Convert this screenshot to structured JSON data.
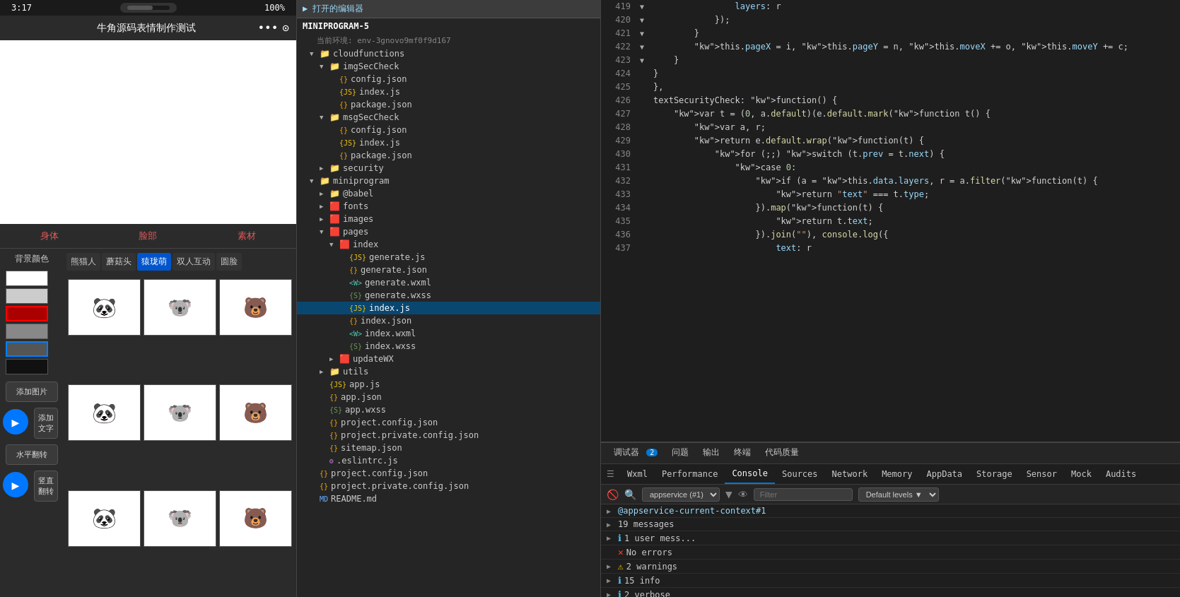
{
  "phone": {
    "status_time": "3:17",
    "status_battery": "100%",
    "title": "牛角源码表情制作测试",
    "tabs": [
      "身体",
      "脸部",
      "素材"
    ],
    "bg_label": "背景颜色",
    "categories": [
      "熊猫人",
      "蘑菇头",
      "猿珑萌",
      "双人互动",
      "圆脸"
    ],
    "btn_add_img": "添加图片",
    "btn_add_txt": "添加文字",
    "btn_hflip": "水平翻转",
    "btn_vflip": "竖直翻转"
  },
  "filetree": {
    "toolbar_label": "▶ 打开的编辑器",
    "project_name": "MINIPROGRAM-5",
    "env_label": "当前环境: env-3gnovo9mf0f9d167",
    "items": [
      {
        "indent": 1,
        "arrow": "▼",
        "icon": "folder",
        "name": "cloudfunctions"
      },
      {
        "indent": 2,
        "arrow": "▼",
        "icon": "folder",
        "name": "imgSecCheck"
      },
      {
        "indent": 3,
        "arrow": "",
        "icon": "json",
        "name": "config.json"
      },
      {
        "indent": 3,
        "arrow": "",
        "icon": "js",
        "name": "index.js"
      },
      {
        "indent": 3,
        "arrow": "",
        "icon": "json",
        "name": "package.json"
      },
      {
        "indent": 2,
        "arrow": "▼",
        "icon": "folder",
        "name": "msgSecCheck"
      },
      {
        "indent": 3,
        "arrow": "",
        "icon": "json",
        "name": "config.json"
      },
      {
        "indent": 3,
        "arrow": "",
        "icon": "js",
        "name": "index.js"
      },
      {
        "indent": 3,
        "arrow": "",
        "icon": "json",
        "name": "package.json"
      },
      {
        "indent": 2,
        "arrow": "▶",
        "icon": "folder",
        "name": "security"
      },
      {
        "indent": 1,
        "arrow": "▼",
        "icon": "folder",
        "name": "miniprogram"
      },
      {
        "indent": 2,
        "arrow": "▶",
        "icon": "folder",
        "name": "@babel"
      },
      {
        "indent": 2,
        "arrow": "▶",
        "icon": "folder-red",
        "name": "fonts"
      },
      {
        "indent": 2,
        "arrow": "▶",
        "icon": "folder-red",
        "name": "images"
      },
      {
        "indent": 2,
        "arrow": "▼",
        "icon": "folder-red",
        "name": "pages"
      },
      {
        "indent": 3,
        "arrow": "▼",
        "icon": "folder-red",
        "name": "index"
      },
      {
        "indent": 4,
        "arrow": "",
        "icon": "js",
        "name": "generate.js"
      },
      {
        "indent": 4,
        "arrow": "",
        "icon": "json",
        "name": "generate.json"
      },
      {
        "indent": 4,
        "arrow": "",
        "icon": "wxml",
        "name": "generate.wxml"
      },
      {
        "indent": 4,
        "arrow": "",
        "icon": "wxss",
        "name": "generate.wxss"
      },
      {
        "indent": 4,
        "arrow": "",
        "icon": "js",
        "name": "index.js",
        "active": true
      },
      {
        "indent": 4,
        "arrow": "",
        "icon": "json",
        "name": "index.json"
      },
      {
        "indent": 4,
        "arrow": "",
        "icon": "wxml",
        "name": "index.wxml"
      },
      {
        "indent": 4,
        "arrow": "",
        "icon": "wxss",
        "name": "index.wxss"
      },
      {
        "indent": 3,
        "arrow": "▶",
        "icon": "folder-red",
        "name": "updateWX"
      },
      {
        "indent": 2,
        "arrow": "▶",
        "icon": "folder",
        "name": "utils"
      },
      {
        "indent": 2,
        "arrow": "",
        "icon": "js",
        "name": "app.js"
      },
      {
        "indent": 2,
        "arrow": "",
        "icon": "json",
        "name": "app.json"
      },
      {
        "indent": 2,
        "arrow": "",
        "icon": "wxss",
        "name": "app.wxss"
      },
      {
        "indent": 2,
        "arrow": "",
        "icon": "json",
        "name": "project.config.json"
      },
      {
        "indent": 2,
        "arrow": "",
        "icon": "json",
        "name": "project.private.config.json"
      },
      {
        "indent": 2,
        "arrow": "",
        "icon": "json",
        "name": "sitemap.json"
      },
      {
        "indent": 2,
        "arrow": "",
        "icon": "eslint",
        "name": ".eslintrc.js"
      },
      {
        "indent": 1,
        "arrow": "",
        "icon": "json",
        "name": "project.config.json"
      },
      {
        "indent": 1,
        "arrow": "",
        "icon": "json",
        "name": "project.private.config.json"
      },
      {
        "indent": 1,
        "arrow": "",
        "icon": "md",
        "name": "README.md"
      }
    ]
  },
  "code": {
    "lines": [
      {
        "num": 419,
        "fold": false,
        "content": "                layers: r"
      },
      {
        "num": 420,
        "fold": false,
        "content": "            });"
      },
      {
        "num": 421,
        "fold": false,
        "content": "        }"
      },
      {
        "num": 422,
        "fold": false,
        "content": "        this.pageX = i, this.pageY = n, this.moveX += o, this.moveY += c;"
      },
      {
        "num": 423,
        "fold": false,
        "content": "    }"
      },
      {
        "num": 424,
        "fold": false,
        "content": "}"
      },
      {
        "num": 425,
        "fold": false,
        "content": "},"
      },
      {
        "num": 426,
        "fold": true,
        "content": "textSecurityCheck: function() {"
      },
      {
        "num": 427,
        "fold": true,
        "content": "    var t = (0, a.default)(e.default.mark(function t() {"
      },
      {
        "num": 428,
        "fold": false,
        "content": "        var a, r;"
      },
      {
        "num": 429,
        "fold": false,
        "content": "        return e.default.wrap(function(t) {"
      },
      {
        "num": 430,
        "fold": false,
        "content": "            for (;;) switch (t.prev = t.next) {"
      },
      {
        "num": 431,
        "fold": false,
        "content": "                case 0:"
      },
      {
        "num": 432,
        "fold": true,
        "content": "                    if (a = this.data.layers, r = a.filter(function(t) {"
      },
      {
        "num": 433,
        "fold": false,
        "content": "                        return \"text\" === t.type;"
      },
      {
        "num": 434,
        "fold": true,
        "content": "                    }).map(function(t) {"
      },
      {
        "num": 435,
        "fold": false,
        "content": "                        return t.text;"
      },
      {
        "num": 436,
        "fold": true,
        "content": "                    }).join(\"\"), console.log({"
      },
      {
        "num": 437,
        "fold": false,
        "content": "                        text: r"
      }
    ]
  },
  "devtools": {
    "tabs": [
      {
        "label": "调试器",
        "badge": "2",
        "active": false
      },
      {
        "label": "问题",
        "badge": "",
        "active": false
      },
      {
        "label": "输出",
        "badge": "",
        "active": false
      },
      {
        "label": "终端",
        "badge": "",
        "active": false
      },
      {
        "label": "代码质量",
        "badge": "",
        "active": false
      }
    ],
    "panel_tabs": [
      "Wxml",
      "Performance",
      "Console",
      "Sources",
      "Network",
      "Memory",
      "AppData",
      "Storage",
      "Sensor",
      "Mock",
      "Audits"
    ],
    "active_panel": "Console",
    "toolbar": {
      "appservice_label": "appservice (#1)",
      "filter_placeholder": "Filter",
      "levels_label": "Default levels"
    },
    "console_link": "@appservice-current-context#1",
    "messages": [
      {
        "icon": "expand",
        "count": "19 messages",
        "type": "group"
      },
      {
        "icon": "expand",
        "count": "1 user mess...",
        "type": "group"
      },
      {
        "icon": "error",
        "text": "No errors",
        "type": "error"
      },
      {
        "icon": "expand",
        "count": "2 warnings",
        "type": "warn"
      },
      {
        "icon": "expand",
        "count": "15 info",
        "type": "info"
      },
      {
        "icon": "expand",
        "count": "2 verbose",
        "type": "verbose"
      }
    ]
  }
}
